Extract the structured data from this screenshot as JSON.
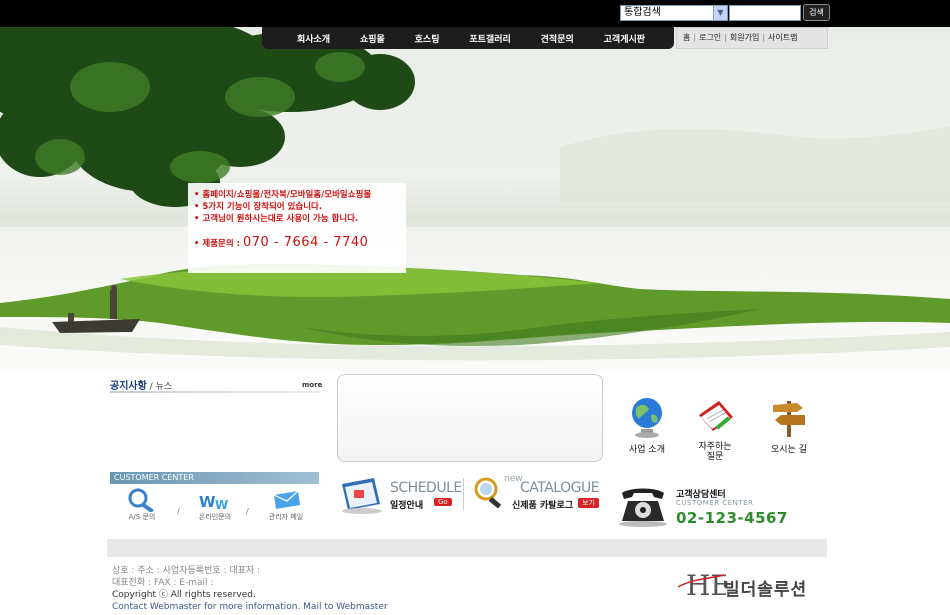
{
  "search": {
    "scope_value": "통합검색",
    "button_label": "검색"
  },
  "main_nav": {
    "items": [
      "회사소개",
      "쇼핑몰",
      "호스팅",
      "포트갤러리",
      "견적문의",
      "고객게시판"
    ]
  },
  "util_nav": {
    "home": "홈",
    "login": "로그인",
    "join": "회원가입",
    "sitemap": "사이트맵",
    "sep": "|"
  },
  "promo": {
    "lines": [
      "• 홈페이지/쇼핑몰/전자북/모바일홈/모바일쇼핑몰",
      "• 5가지 기능이 장착되어 있습니다.",
      "• 고객님이 원하시는대로 사용이 가능 합니다."
    ],
    "phone_label": "• 제품문의 : ",
    "phone_number": "070 - 7664 - 7740"
  },
  "notice": {
    "title": "공지사항",
    "divider": " / ",
    "sub": "뉴스",
    "more": "more"
  },
  "quick_links": [
    "사업 소개",
    "자주하는 질문",
    "오시는 길"
  ],
  "customer_center": {
    "bar_label": "CUSTOMER CENTER",
    "items": [
      "A/S 문의",
      "온라인문의",
      "관리자 메일"
    ],
    "sep": "/"
  },
  "schedule": {
    "big": "SCHEDULE",
    "small": "일정안내",
    "go": "Go"
  },
  "catalogue": {
    "new": "new",
    "big": "CATALOGUE",
    "small": "신제품 카탈로그",
    "view": "보기"
  },
  "phone_center": {
    "title": "고객상담센터",
    "sub": "CUSTOMER CENTER",
    "number": "02-123-4567"
  },
  "footer": {
    "line1": "상호 : 주소 : 사업자등록번호 : 대표자 :",
    "line2": "대표전화 : FAX : E-mail :",
    "copyright": "Copyright ⓒ All rights reserved.",
    "contact": "Contact Webmaster for more information. Mail to Webmaster",
    "logo_mark": "HE",
    "logo_text": "빌더솔루션"
  }
}
